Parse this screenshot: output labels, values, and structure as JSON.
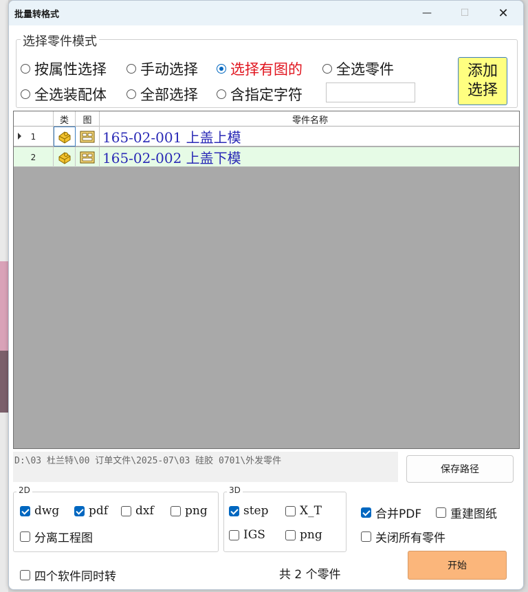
{
  "window": {
    "title": "批量转格式"
  },
  "select_mode": {
    "label": "选择零件模式",
    "options": [
      {
        "label": "按属性选择",
        "checked": false
      },
      {
        "label": "手动选择",
        "checked": false
      },
      {
        "label": "选择有图的",
        "checked": true
      },
      {
        "label": "全选零件",
        "checked": false
      },
      {
        "label": "全选装配体",
        "checked": false
      },
      {
        "label": "全部选择",
        "checked": false
      },
      {
        "label": "含指定字符",
        "checked": false
      }
    ],
    "filter_value": "",
    "add_button": "添加\n选择"
  },
  "grid": {
    "headers": {
      "type": "类",
      "drawing": "图",
      "name": "零件名称"
    },
    "rows": [
      {
        "num": "1",
        "name": "165-02-001  上盖上模",
        "selected": true
      },
      {
        "num": "2",
        "name": "165-02-002  上盖下模",
        "selected": false
      }
    ],
    "row_colors": [
      "#ffffff",
      "#e6fbe6"
    ]
  },
  "path": {
    "value": "D:\\03 杜兰特\\00 订单文件\\2025-07\\03 硅胶 0701\\外发零件",
    "save_button": "保存路径"
  },
  "formats_2d": {
    "label": "2D",
    "options": [
      {
        "label": "dwg",
        "checked": true
      },
      {
        "label": "pdf",
        "checked": true
      },
      {
        "label": "dxf",
        "checked": false
      },
      {
        "label": "png",
        "checked": false
      },
      {
        "label": "分离工程图",
        "checked": false
      }
    ]
  },
  "formats_3d": {
    "label": "3D",
    "options": [
      {
        "label": "step",
        "checked": true
      },
      {
        "label": "X_T",
        "checked": false
      },
      {
        "label": "IGS",
        "checked": false
      },
      {
        "label": "png",
        "checked": false
      }
    ]
  },
  "extra_options": [
    {
      "label": "合并PDF",
      "checked": true
    },
    {
      "label": "重建图纸",
      "checked": false
    },
    {
      "label": "关闭所有零件",
      "checked": false
    },
    {
      "label": "四个软件同时转",
      "checked": false
    }
  ],
  "footer": {
    "count_text": "共 2 个零件",
    "start_button": "开始"
  },
  "colors": {
    "accent": "#0067c0",
    "start": "#fbb67b",
    "add": "#ffff80",
    "grid_bg": "#a9a9a9"
  }
}
